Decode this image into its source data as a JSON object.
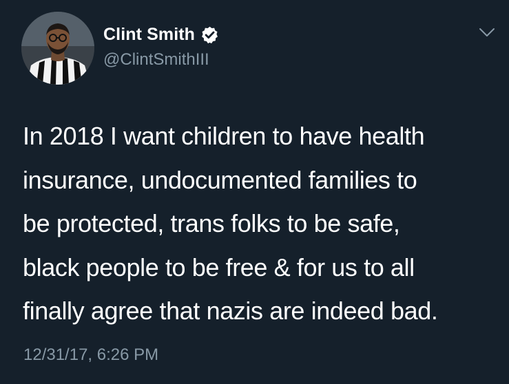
{
  "user": {
    "display_name": "Clint Smith",
    "handle": "@ClintSmithIII",
    "verified": true
  },
  "tweet": {
    "lines": [
      "In 2018 I want children to have health",
      "insurance, undocumented families to",
      "be protected, trans folks to be safe,",
      "black people to be free & for us to all",
      "finally agree that nazis are indeed bad."
    ],
    "timestamp": "12/31/17, 6:26 PM"
  },
  "icons": {
    "verified": "verified-check-icon",
    "menu": "chevron-down-icon"
  },
  "colors": {
    "background": "#15202b",
    "primary_text": "#ffffff",
    "secondary_text": "#8899a6"
  }
}
